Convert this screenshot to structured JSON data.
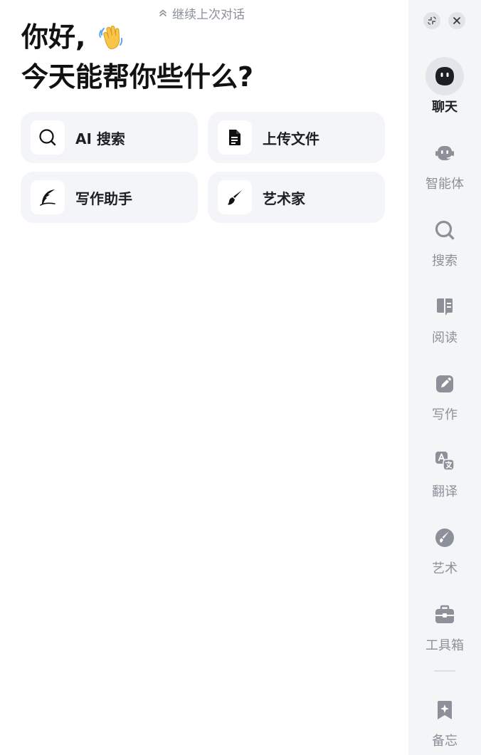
{
  "continue_link": {
    "label": "继续上次对话"
  },
  "greeting": {
    "line1": "你好,",
    "line2": "今天能帮你些什么?"
  },
  "cards": [
    {
      "label": "AI 搜索",
      "icon": "search-icon"
    },
    {
      "label": "上传文件",
      "icon": "document-icon"
    },
    {
      "label": "写作助手",
      "icon": "quill-icon"
    },
    {
      "label": "艺术家",
      "icon": "paintbrush-icon"
    }
  ],
  "window_controls": {
    "collapse_icon": "collapse-icon",
    "close_icon": "close-icon"
  },
  "sidebar": {
    "items": [
      {
        "label": "聊天",
        "icon": "chat-bot-icon",
        "active": true
      },
      {
        "label": "智能体",
        "icon": "agent-icon",
        "active": false
      },
      {
        "label": "搜索",
        "icon": "search-icon",
        "active": false
      },
      {
        "label": "阅读",
        "icon": "read-icon",
        "active": false
      },
      {
        "label": "写作",
        "icon": "edit-icon",
        "active": false
      },
      {
        "label": "翻译",
        "icon": "translate-icon",
        "active": false
      },
      {
        "label": "艺术",
        "icon": "art-icon",
        "active": false
      },
      {
        "label": "工具箱",
        "icon": "toolbox-icon",
        "active": false
      },
      {
        "label": "备忘",
        "icon": "bookmark-icon",
        "active": false
      }
    ]
  },
  "colors": {
    "sidebar_bg": "#f4f5f7",
    "card_bg": "#f4f5f8",
    "icon_gray": "#8c9099",
    "text_dark": "#1e1f24"
  }
}
